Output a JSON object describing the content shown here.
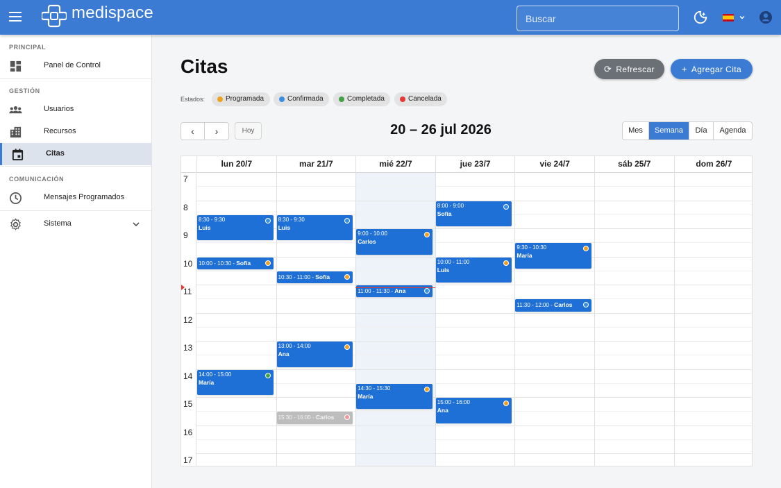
{
  "app": {
    "name": "medispace"
  },
  "topbar": {
    "search_placeholder": "Buscar",
    "icons": [
      "menu-icon",
      "moon-icon",
      "spain-flag-icon",
      "chevron-down-icon",
      "account-icon"
    ]
  },
  "sidebar": {
    "sections": [
      {
        "title": "PRINCIPAL"
      },
      {
        "title": "GESTIÓN"
      },
      {
        "title": "COMUNICACIÓN"
      }
    ],
    "items": [
      {
        "label": "Panel de Control",
        "icon": "dashboard-icon"
      },
      {
        "label": "Usuarios",
        "icon": "users-icon"
      },
      {
        "label": "Recursos",
        "icon": "building-icon"
      },
      {
        "label": "Citas",
        "icon": "calendar-icon",
        "active": true
      },
      {
        "label": "Mensajes Programados",
        "icon": "clock-icon"
      },
      {
        "label": "Sistema",
        "icon": "gear-icon"
      }
    ]
  },
  "main": {
    "title": "Citas",
    "refresh_label": "Refrescar",
    "add_label": "Agregar Cita",
    "estados_label": "Estados:",
    "statuses": [
      {
        "label": "Programada",
        "color": "#f0a020"
      },
      {
        "label": "Confirmada",
        "color": "#3b8fe0"
      },
      {
        "label": "Completada",
        "color": "#43a047"
      },
      {
        "label": "Cancelada",
        "color": "#e53935"
      }
    ]
  },
  "toolbar": {
    "prev_icon": "chevron-left-icon",
    "next_icon": "chevron-right-icon",
    "today_label": "Hoy",
    "range_title": "20 – 26 jul 2026",
    "views": [
      {
        "label": "Mes"
      },
      {
        "label": "Semana",
        "active": true
      },
      {
        "label": "Día"
      },
      {
        "label": "Agenda"
      }
    ]
  },
  "calendar": {
    "days": [
      "lun 20/7",
      "mar 21/7",
      "mié 22/7",
      "jue 23/7",
      "vie 24/7",
      "sáb 25/7",
      "dom 26/7"
    ],
    "today_index": 2,
    "hours": [
      "7",
      "8",
      "9",
      "10",
      "11",
      "12",
      "13",
      "14",
      "15",
      "16",
      "17"
    ],
    "first_hour": 7,
    "now_time": 11.1,
    "events": [
      {
        "day": 0,
        "start": 8.5,
        "end": 9.5,
        "time": "8:30 - 9:30",
        "name": "Luis",
        "status": "Confirmada"
      },
      {
        "day": 0,
        "start": 10,
        "end": 10.5,
        "time": "10:00 - 10:30",
        "name": "Sofía",
        "status": "Programada"
      },
      {
        "day": 0,
        "start": 14,
        "end": 15,
        "time": "14:00 - 15:00",
        "name": "María",
        "status": "Completada"
      },
      {
        "day": 1,
        "start": 8.5,
        "end": 9.5,
        "time": "8:30 - 9:30",
        "name": "Luis",
        "status": "Confirmada"
      },
      {
        "day": 1,
        "start": 10.5,
        "end": 11,
        "time": "10:30 - 11:00",
        "name": "Sofía",
        "status": "Programada"
      },
      {
        "day": 1,
        "start": 13,
        "end": 14,
        "time": "13:00 - 14:00",
        "name": "Ana",
        "status": "Programada"
      },
      {
        "day": 1,
        "start": 15.5,
        "end": 16,
        "time": "15:30 - 16:00",
        "name": "Carlos",
        "status": "Cancelada"
      },
      {
        "day": 2,
        "start": 9,
        "end": 10,
        "time": "9:00 - 10:00",
        "name": "Carlos",
        "status": "Programada"
      },
      {
        "day": 2,
        "start": 11,
        "end": 11.5,
        "time": "11:00 - 11:30",
        "name": "Ana",
        "status": "Confirmada"
      },
      {
        "day": 2,
        "start": 14.5,
        "end": 15.5,
        "time": "14:30 - 15:30",
        "name": "María",
        "status": "Programada"
      },
      {
        "day": 3,
        "start": 8,
        "end": 9,
        "time": "8:00 - 9:00",
        "name": "Sofía",
        "status": "Confirmada"
      },
      {
        "day": 3,
        "start": 10,
        "end": 11,
        "time": "10:00 - 11:00",
        "name": "Luis",
        "status": "Programada"
      },
      {
        "day": 3,
        "start": 15,
        "end": 16,
        "time": "15:00 - 16:00",
        "name": "Ana",
        "status": "Programada"
      },
      {
        "day": 4,
        "start": 9.5,
        "end": 10.5,
        "time": "9:30 - 10:30",
        "name": "María",
        "status": "Programada"
      },
      {
        "day": 4,
        "start": 11.5,
        "end": 12,
        "time": "11:30 - 12:00",
        "name": "Carlos",
        "status": "Confirmada"
      }
    ]
  }
}
